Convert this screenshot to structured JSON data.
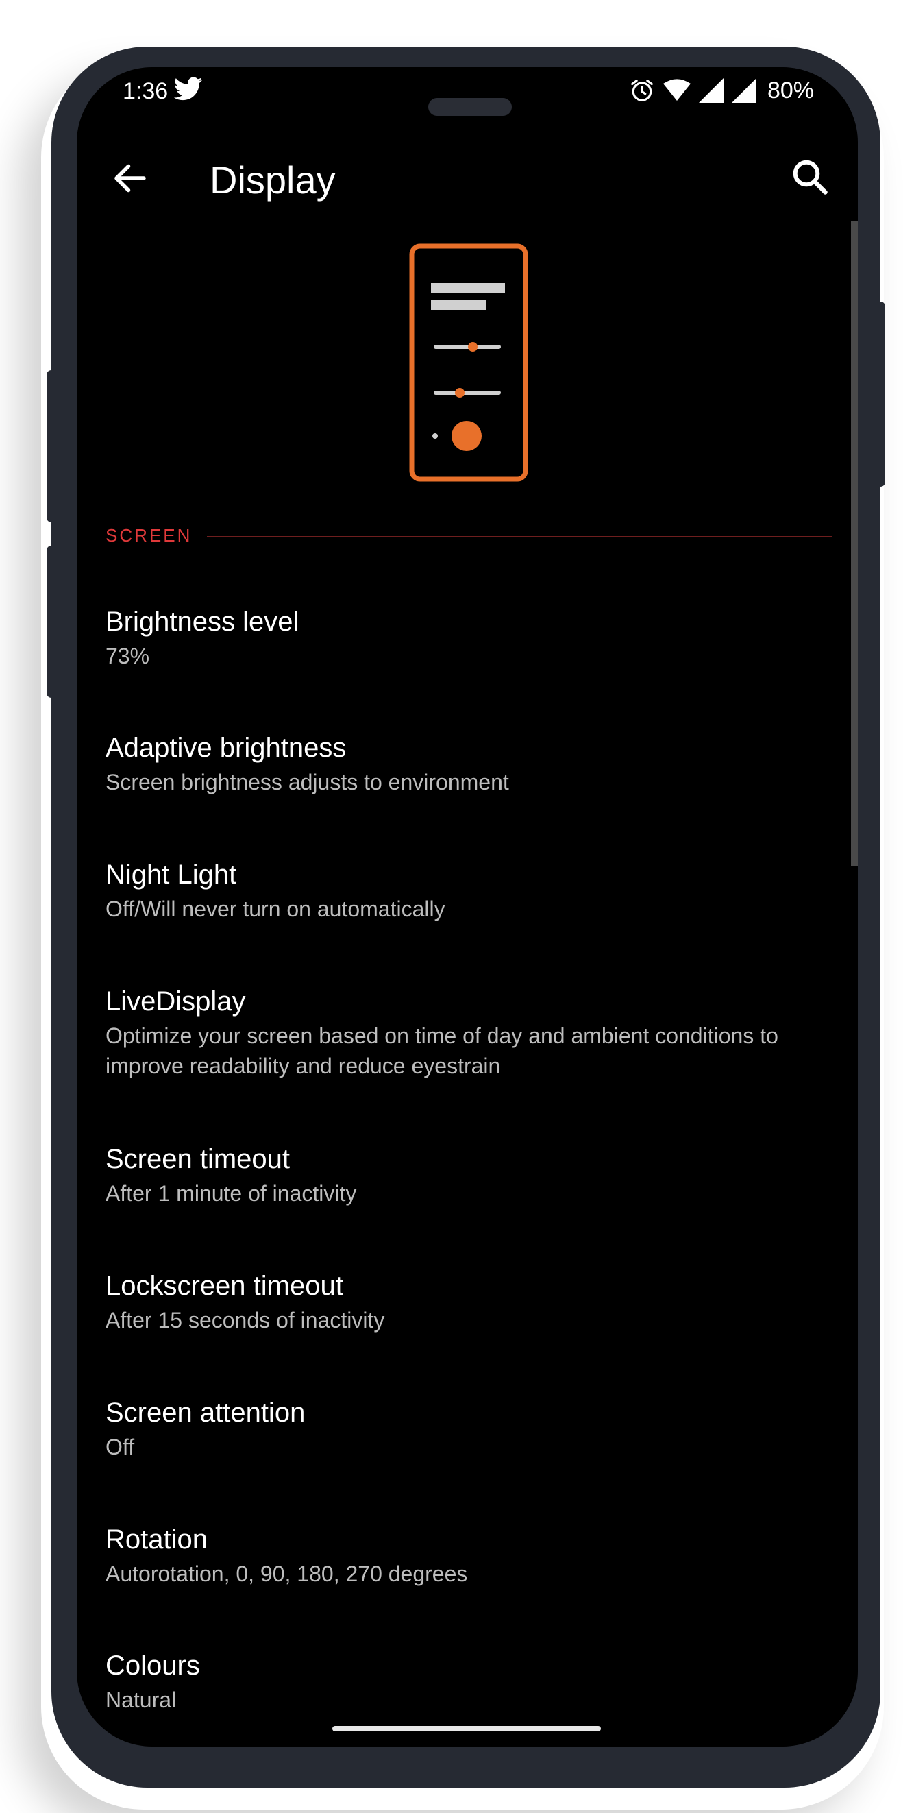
{
  "status_bar": {
    "time": "1:36",
    "battery": "80%",
    "icons": [
      "twitter-icon",
      "alarm-icon",
      "wifi-icon",
      "signal-icon",
      "signal-icon"
    ]
  },
  "app_bar": {
    "title": "Display",
    "back_icon": "arrow-left-icon",
    "search_icon": "search-icon"
  },
  "colors": {
    "accent": "#e8702a",
    "section_header": "#e0393a",
    "background": "#000000",
    "summary_text": "#bdbdbd"
  },
  "section": {
    "label": "SCREEN"
  },
  "items": [
    {
      "title": "Brightness level",
      "summary": "73%"
    },
    {
      "title": "Adaptive brightness",
      "summary": "Screen brightness adjusts to environment"
    },
    {
      "title": "Night Light",
      "summary": "Off/Will never turn on automatically"
    },
    {
      "title": "LiveDisplay",
      "summary": "Optimize your screen based on time of day and ambient conditions to improve readability and reduce eyestrain"
    },
    {
      "title": "Screen timeout",
      "summary": "After 1 minute of inactivity"
    },
    {
      "title": "Lockscreen timeout",
      "summary": "After 15 seconds of inactivity"
    },
    {
      "title": "Screen attention",
      "summary": "Off"
    },
    {
      "title": "Rotation",
      "summary": "Autorotation, 0, 90, 180, 270 degrees"
    },
    {
      "title": "Colours",
      "summary": "Natural"
    }
  ]
}
